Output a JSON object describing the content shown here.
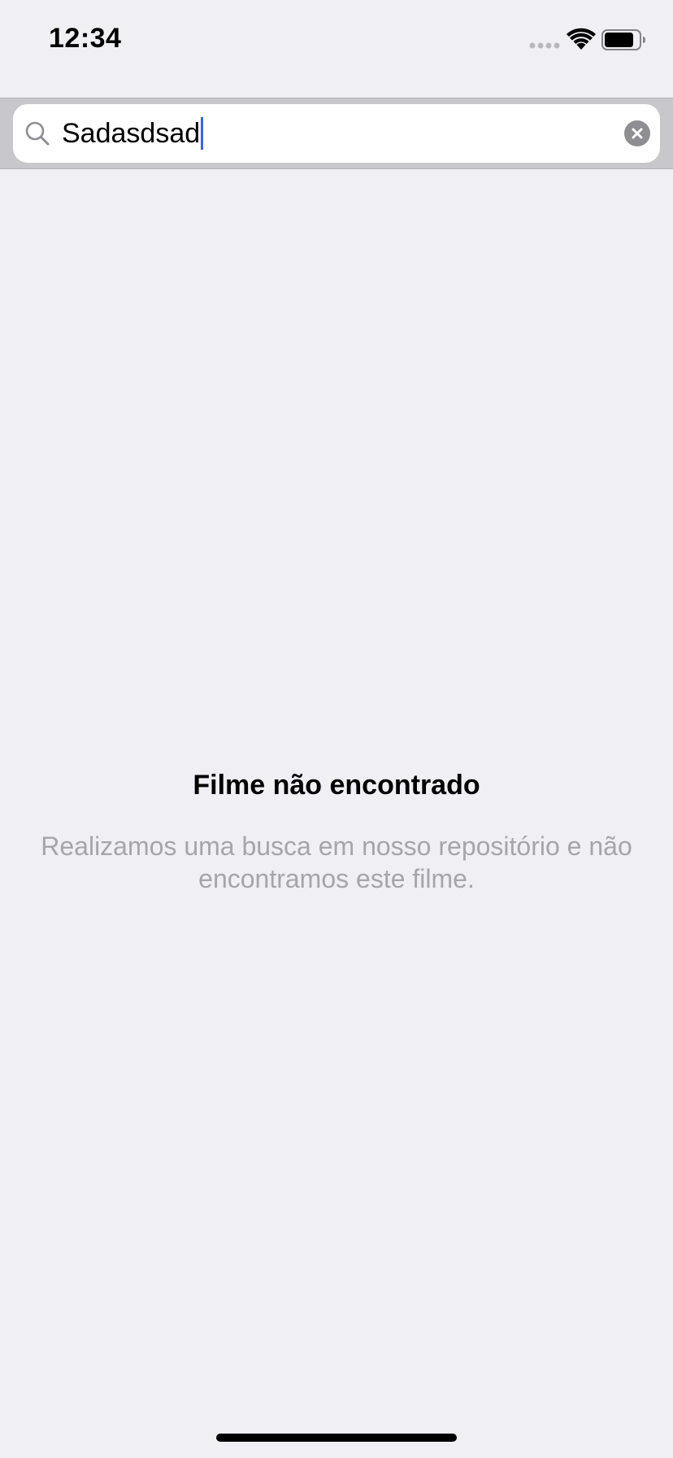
{
  "status_bar": {
    "time": "12:34",
    "icons": [
      "signal-dots-icon",
      "wifi-icon",
      "battery-icon"
    ]
  },
  "search": {
    "value": "Sadasdsad",
    "icon": "search-icon",
    "clear_icon": "clear-icon"
  },
  "empty_state": {
    "title": "Filme não encontrado",
    "message": "Realizamos uma busca em nosso repositório e não encontramos este filme."
  },
  "colors": {
    "background": "#efeff4",
    "search_bar": "#c8c7cc",
    "caret": "#3b63e0",
    "message_text": "#a6a6aa"
  }
}
